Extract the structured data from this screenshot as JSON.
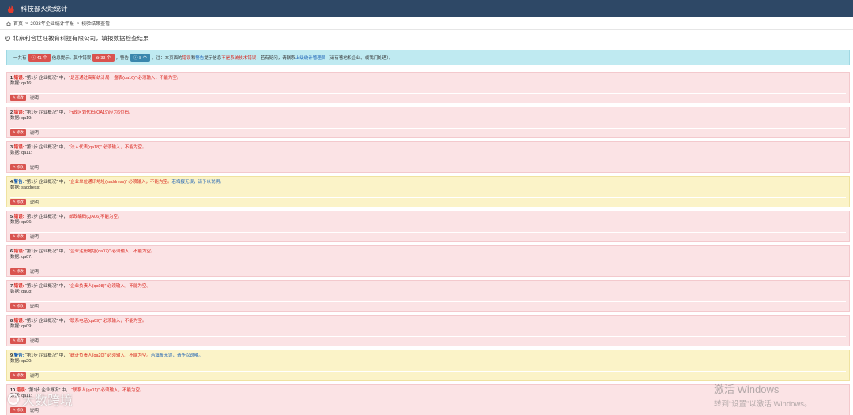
{
  "app": {
    "title": "科技部火炬统计"
  },
  "breadcrumb": {
    "home": "首页",
    "level2": "2023年企业统计年报",
    "level3": "校验结果查看"
  },
  "page_title": "北京利合世旺教育科技有限公司，填报数据检查结果",
  "summary": {
    "prefix": "一共有",
    "total_badge": "41 个",
    "mid1": "信息提示。其中错误",
    "error_badge": "33 个",
    "mid2": "，警告",
    "warning_badge": "8 个",
    "mid3": "。注：本页面的",
    "red_word": "错误",
    "mid4": "和",
    "blue_word": "警告",
    "mid5": "提示信息",
    "red_note": "不是系统技术错误",
    "mid6": "，若有疑问，请联系",
    "blue_note": "上级统计管理员",
    "suffix": "（请有著地和企业、或我们处理）。"
  },
  "labels": {
    "data": "数据:",
    "note": "说明:",
    "edit": "修改"
  },
  "items": [
    {
      "num": "1.",
      "type": "错误:",
      "section": "“第1步 企业概况” 中，",
      "msg": "“是否通过高新统计局一盘表(qa16)” 必须输入，不能为空。",
      "hint": "",
      "data": "qa16:"
    },
    {
      "num": "2.",
      "type": "错误:",
      "section": "“第1步 企业概况” 中，",
      "msg": "行政区划代码(QA19)应为6位码。",
      "hint": "",
      "data": "qa19:"
    },
    {
      "num": "3.",
      "type": "错误:",
      "section": "“第1步 企业概况” 中，",
      "msg": "“法人代表(qa18)” 必须输入，不能为空。",
      "hint": "",
      "data": "qa11:"
    },
    {
      "num": "4.",
      "type": "警告:",
      "section": "“第1步 企业概况” 中，",
      "msg": "“企业单位通讯地址(saddress)” 必须输入，不能为空。",
      "hint": "若填报无误，请予以说明。",
      "data": "saddress:"
    },
    {
      "num": "5.",
      "type": "错误:",
      "section": "“第1步 企业概况” 中，",
      "msg": "邮政编码(QA06)不能为空。",
      "hint": "",
      "data": "qa06:"
    },
    {
      "num": "6.",
      "type": "错误:",
      "section": "“第1步 企业概况” 中，",
      "msg": "“企业注册地址(qa07)” 必须输入，不能为空。",
      "hint": "",
      "data": "qa07:"
    },
    {
      "num": "7.",
      "type": "错误:",
      "section": "“第1步 企业概况” 中，",
      "msg": "“企业负责人(qa08)” 必须输入，不能为空。",
      "hint": "",
      "data": "qa08:"
    },
    {
      "num": "8.",
      "type": "错误:",
      "section": "“第1步 企业概况” 中，",
      "msg": "“联系电话(qa09)” 必须输入，不能为空。",
      "hint": "",
      "data": "qa09:"
    },
    {
      "num": "9.",
      "type": "警告:",
      "section": "“第1步 企业概况” 中，",
      "msg": "“统计负责人(qa20)” 必须输入，不能为空。",
      "hint": "若填报无误，请予以说明。",
      "data": "qa20:"
    },
    {
      "num": "10.",
      "type": "错误:",
      "section": "“第1步 企业概况” 中，",
      "msg": "“联系人(qa11)” 必须输入，不能为空。",
      "hint": "",
      "data": "qa11:"
    }
  ],
  "watermark": "大数跨境",
  "windows_activation": {
    "line1": "激活 Windows",
    "line2": "转到“设置”以激活 Windows。"
  },
  "colors": {
    "topbar": "#2e4866",
    "error_bg": "#fbe3e5",
    "warning_bg": "#fbf3c8",
    "summary_bg": "#bfeaf1",
    "error_text": "#d9241c",
    "hint_text": "#1a5fb4"
  },
  "icons": {
    "logo": "flame-logo-icon",
    "home": "home-icon",
    "check": "check-circle-icon",
    "edit": "pencil-icon"
  }
}
